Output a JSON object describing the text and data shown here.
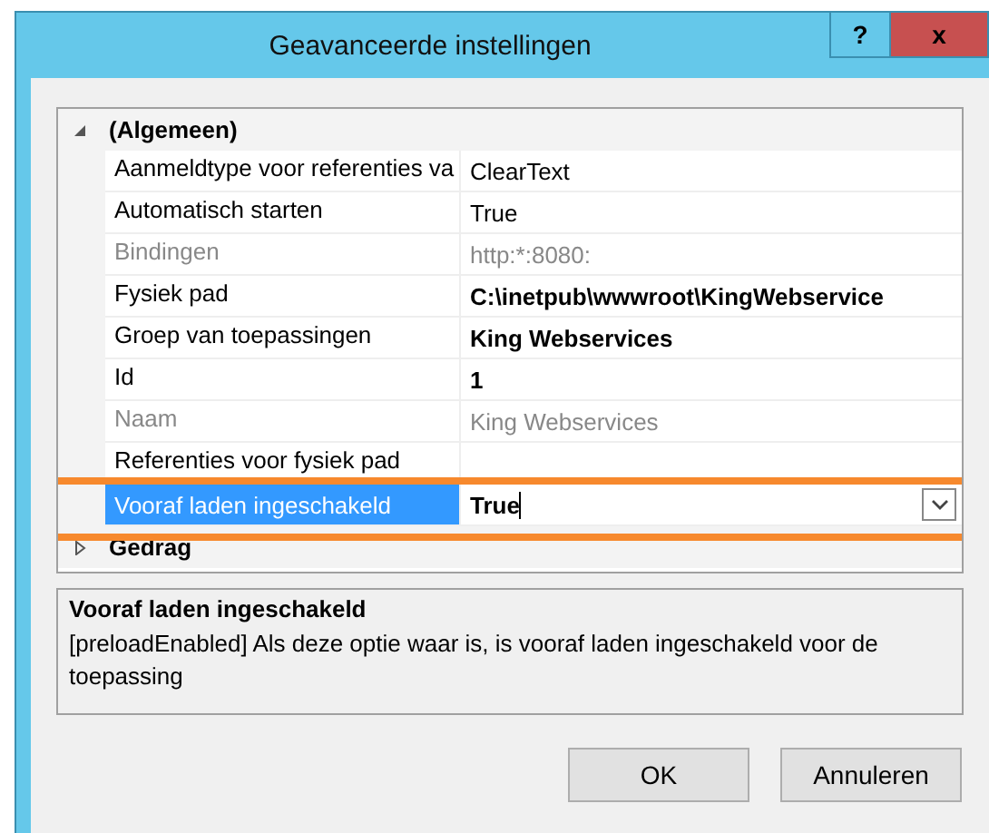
{
  "window": {
    "title": "Geavanceerde instellingen",
    "buttons": [
      {
        "kind": "help",
        "label": "?"
      },
      {
        "kind": "close",
        "label": "x"
      }
    ]
  },
  "property_grid": {
    "categories": [
      {
        "name": "(Algemeen)",
        "expanded": true,
        "rows": [
          {
            "label": "Aanmeldtype voor referenties va",
            "value": "ClearText",
            "disabled": false,
            "bold": false,
            "selected": false
          },
          {
            "label": "Automatisch starten",
            "value": "True",
            "disabled": false,
            "bold": false,
            "selected": false
          },
          {
            "label": "Bindingen",
            "value": "http:*:8080:",
            "disabled": true,
            "bold": false,
            "selected": false
          },
          {
            "label": "Fysiek pad",
            "value": "C:\\inetpub\\wwwroot\\KingWebservice",
            "disabled": false,
            "bold": true,
            "selected": false
          },
          {
            "label": "Groep van toepassingen",
            "value": "King Webservices",
            "disabled": false,
            "bold": true,
            "selected": false
          },
          {
            "label": "Id",
            "value": "1",
            "disabled": false,
            "bold": true,
            "selected": false
          },
          {
            "label": "Naam",
            "value": "King Webservices",
            "disabled": true,
            "bold": false,
            "selected": false
          },
          {
            "label": "Referenties voor fysiek pad",
            "disabled": false,
            "selected": false
          },
          {
            "label": "Vooraf laden ingeschakeld",
            "value": "True",
            "disabled": false,
            "bold": true,
            "selected": true,
            "highlighted": true,
            "kind": "dropdown"
          }
        ]
      },
      {
        "name": "Gedrag",
        "expanded": false
      }
    ]
  },
  "description": {
    "title": "Vooraf laden ingeschakeld",
    "text": "[preloadEnabled] Als deze optie waar is, is vooraf laden ingeschakeld voor de toepassing"
  },
  "buttons": [
    "OK",
    "Annuleren"
  ]
}
